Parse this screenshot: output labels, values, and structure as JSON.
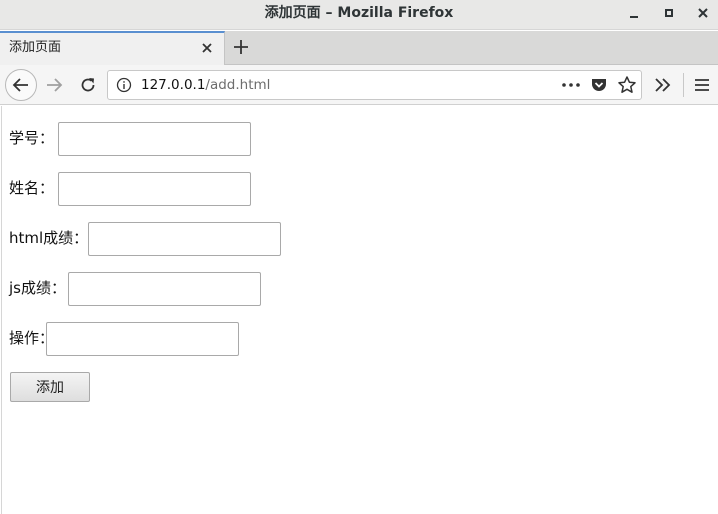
{
  "window": {
    "title": "添加页面 – Mozilla Firefox"
  },
  "tabs": [
    {
      "label": "添加页面",
      "active": true
    }
  ],
  "navbar": {
    "url_host": "127.0.0.1",
    "url_path": "/add.html"
  },
  "form": {
    "fields": [
      {
        "label": "学号：",
        "value": ""
      },
      {
        "label": "姓名：",
        "value": ""
      },
      {
        "label": "html成绩：",
        "value": ""
      },
      {
        "label": "js成绩：",
        "value": ""
      },
      {
        "label": "操作：",
        "value": ""
      }
    ],
    "submit_label": "添加"
  },
  "colors": {
    "tab_accent": "#5a8fd0",
    "chrome_bg": "#e8e8e7"
  },
  "icons": [
    "minimize-icon",
    "maximize-icon",
    "close-icon",
    "tab-close-icon",
    "new-tab-icon",
    "back-arrow-icon",
    "forward-arrow-icon",
    "reload-icon",
    "info-icon",
    "page-actions-icon",
    "pocket-icon",
    "bookmark-star-icon",
    "overflow-chevrons-icon",
    "hamburger-menu-icon"
  ]
}
